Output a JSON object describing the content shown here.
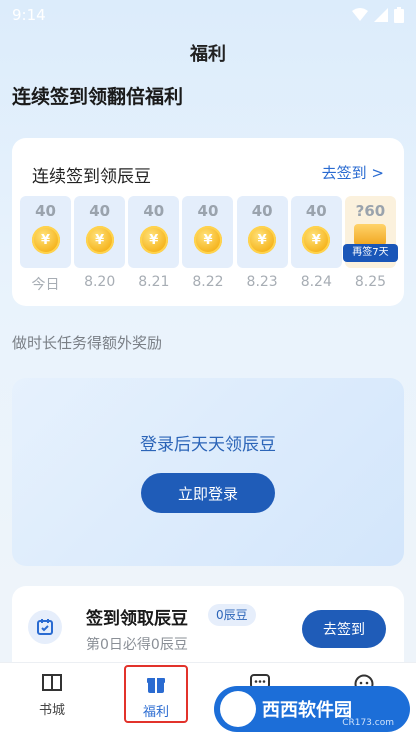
{
  "status_bar": {
    "time": "9:14"
  },
  "header": {
    "title": "福利"
  },
  "section_heading": "连续签到领翻倍福利",
  "checkin": {
    "title": "连续签到领辰豆",
    "link": "去签到 >",
    "days": [
      {
        "value": "40",
        "label": "今日"
      },
      {
        "value": "40",
        "label": "8.20"
      },
      {
        "value": "40",
        "label": "8.21"
      },
      {
        "value": "40",
        "label": "8.22"
      },
      {
        "value": "40",
        "label": "8.23"
      },
      {
        "value": "40",
        "label": "8.24"
      },
      {
        "value": "?60",
        "label": "8.25",
        "badge": "再签7天"
      }
    ],
    "coin_symbol": "¥"
  },
  "hint": "做时长任务得额外奖励",
  "login": {
    "message": "登录后天天领辰豆",
    "button": "立即登录"
  },
  "task": {
    "title": "签到领取辰豆",
    "badge": "0辰豆",
    "subtitle": "第0日必得0辰豆",
    "button": "去签到"
  },
  "nav": {
    "items": [
      {
        "label": "书城"
      },
      {
        "label": "福利"
      },
      {
        "label": ""
      },
      {
        "label": ""
      }
    ]
  },
  "watermark": {
    "text": "西西软件园",
    "sub": "CR173.com"
  },
  "colors": {
    "accent": "#1f5cb8",
    "link": "#2a6bd1",
    "highlight": "#e2322b"
  }
}
